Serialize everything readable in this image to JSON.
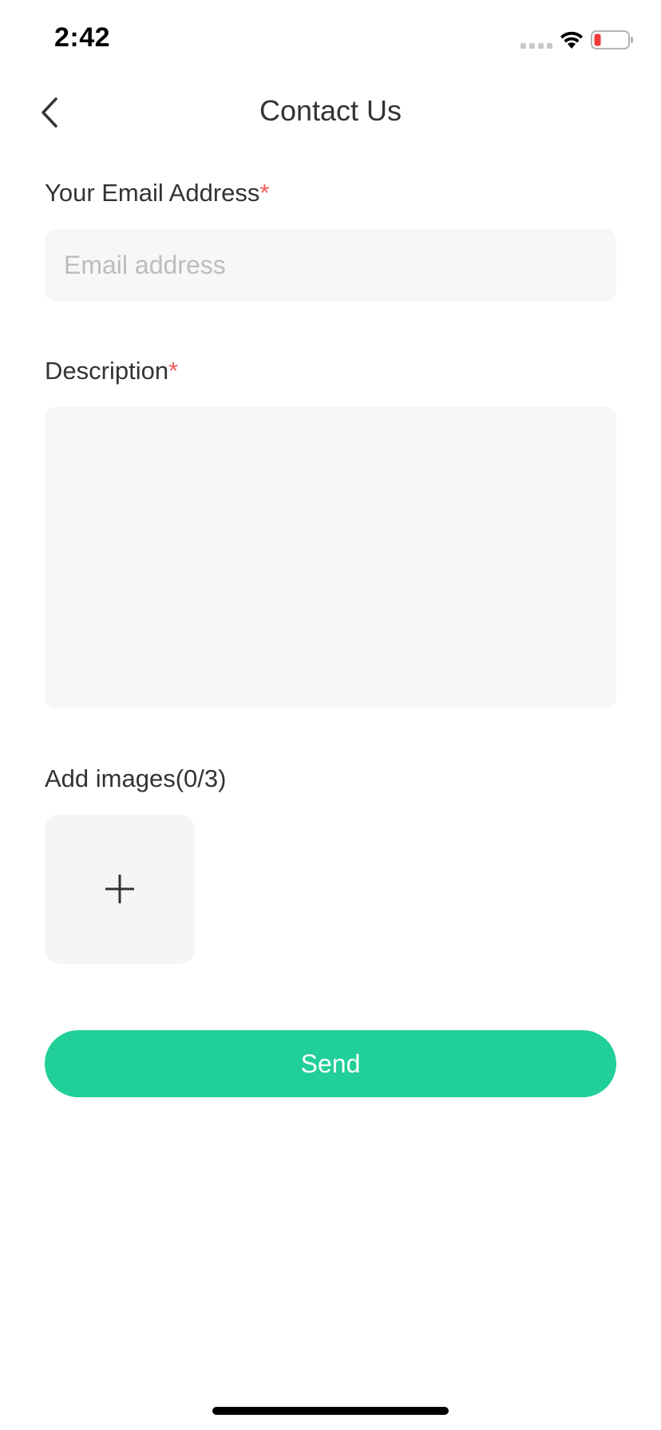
{
  "status_bar": {
    "time": "2:42",
    "battery_color": "#f03a3a"
  },
  "nav": {
    "title": "Contact Us",
    "back_icon": "chevron-left-icon"
  },
  "form": {
    "email": {
      "label": "Your Email Address",
      "required_mark": "*",
      "placeholder": "Email address",
      "value": ""
    },
    "description": {
      "label": "Description",
      "required_mark": "*",
      "value": ""
    },
    "images": {
      "label": "Add images(0/3)",
      "add_icon": "plus-icon"
    },
    "send_label": "Send"
  },
  "colors": {
    "accent": "#21cf98",
    "required": "#f25b5b",
    "input_bg": "#f7f7f7"
  }
}
